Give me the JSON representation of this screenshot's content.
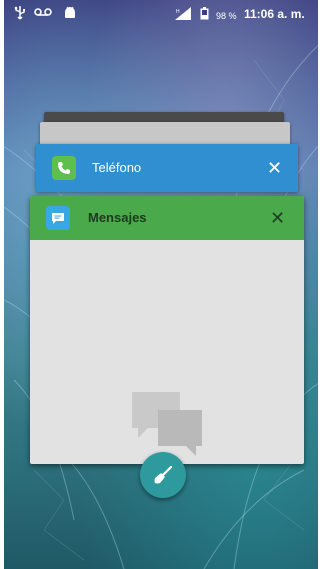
{
  "status_bar": {
    "usb_icon": "usb-icon",
    "voicemail_icon": "voicemail-icon",
    "android_icon": "android-icon",
    "signal_icon": "signal-icon",
    "battery_icon": "battery-icon",
    "battery_percent": "98 %",
    "time": "11:06 a. m."
  },
  "recents": {
    "cards": [
      {
        "label": "Teléfono",
        "icon": "phone-icon",
        "color": "#2f8fd0"
      },
      {
        "label": "Mensajes",
        "icon": "message-icon",
        "color": "#4aa94a"
      }
    ],
    "close_glyph": "✕",
    "clear_all_icon": "broom-icon"
  },
  "colors": {
    "telefono_header": "#2f8fd0",
    "mensajes_header": "#4aa94a",
    "clear_button": "#2f9a9d"
  }
}
